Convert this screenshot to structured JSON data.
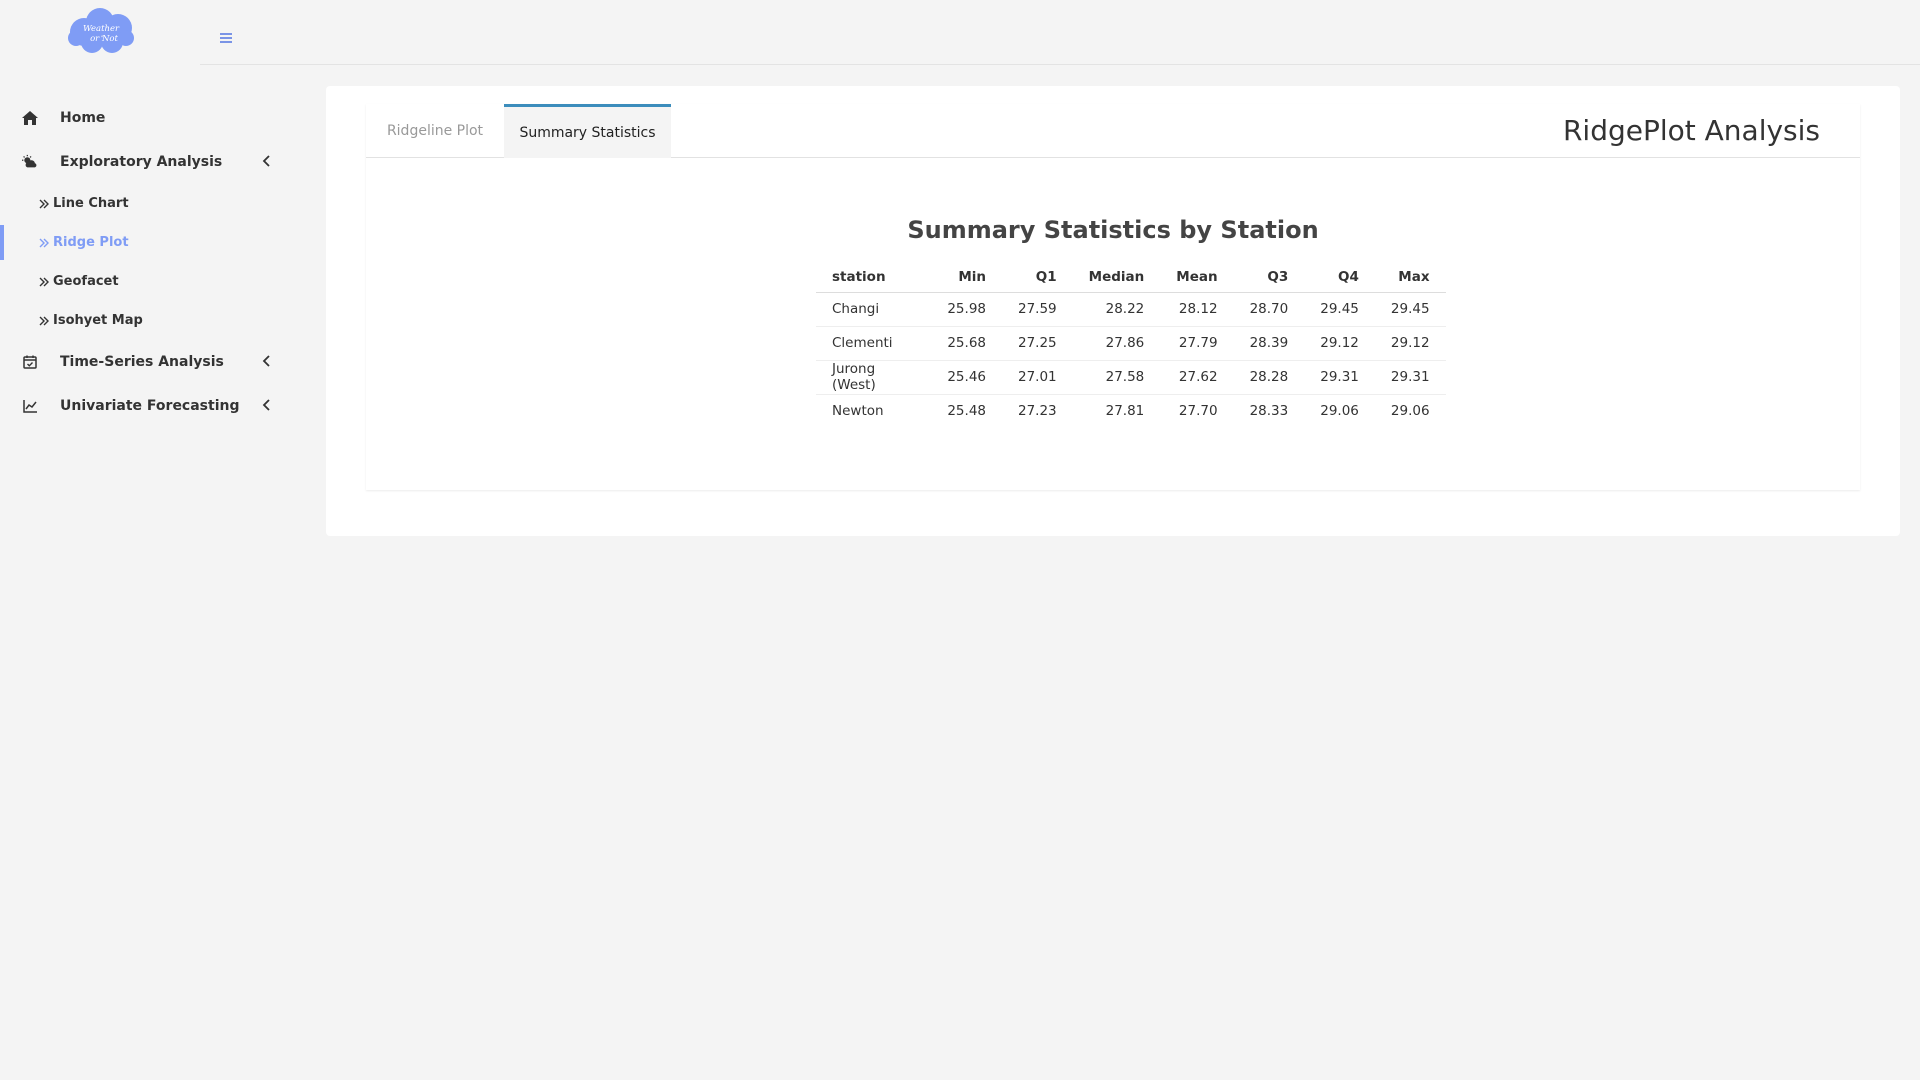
{
  "brand": {
    "logo_text_line1": "Weather",
    "logo_text_line2": "or Not",
    "logo_color": "#7f9cf5"
  },
  "sidebar": {
    "items": [
      {
        "label": "Home",
        "icon": "home-icon"
      },
      {
        "label": "Exploratory Analysis",
        "icon": "cloud-sun-icon",
        "expanded": true,
        "children": [
          {
            "label": "Line Chart"
          },
          {
            "label": "Ridge Plot",
            "active": true
          },
          {
            "label": "Geofacet"
          },
          {
            "label": "Isohyet Map"
          }
        ]
      },
      {
        "label": "Time-Series Analysis",
        "icon": "calendar-check-icon"
      },
      {
        "label": "Univariate Forecasting",
        "icon": "line-chart-icon"
      }
    ]
  },
  "tabs": [
    {
      "label": "Ridgeline Plot",
      "active": false
    },
    {
      "label": "Summary Statistics",
      "active": true
    }
  ],
  "panel_title": "RidgePlot Analysis",
  "table": {
    "title": "Summary Statistics by Station",
    "columns": [
      "station",
      "Min",
      "Q1",
      "Median",
      "Mean",
      "Q3",
      "Q4",
      "Max"
    ],
    "rows": [
      [
        "Changi",
        "25.98",
        "27.59",
        "28.22",
        "28.12",
        "28.70",
        "29.45",
        "29.45"
      ],
      [
        "Clementi",
        "25.68",
        "27.25",
        "27.86",
        "27.79",
        "28.39",
        "29.12",
        "29.12"
      ],
      [
        "Jurong (West)",
        "25.46",
        "27.01",
        "27.58",
        "27.62",
        "28.28",
        "29.31",
        "29.31"
      ],
      [
        "Newton",
        "25.48",
        "27.23",
        "27.81",
        "27.70",
        "28.33",
        "29.06",
        "29.06"
      ]
    ]
  },
  "colors": {
    "accent": "#7f9cf5",
    "tab_border": "#3c8dbc",
    "background": "#f4f4f4"
  }
}
